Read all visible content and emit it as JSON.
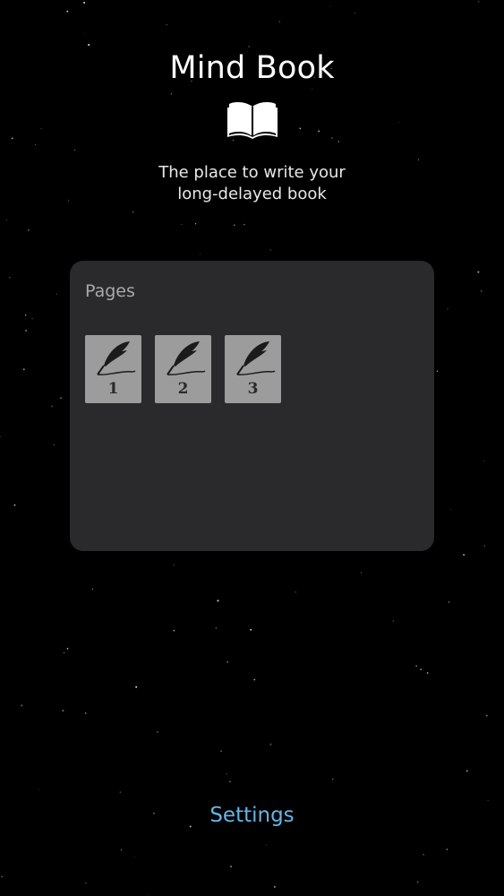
{
  "app": {
    "title": "Mind Book",
    "tagline_line1": "The place to write your",
    "tagline_line2": "long-delayed book"
  },
  "pages_panel": {
    "heading": "Pages",
    "pages": [
      {
        "number": "1",
        "icon": "quill-icon"
      },
      {
        "number": "2",
        "icon": "quill-icon"
      },
      {
        "number": "3",
        "icon": "quill-icon"
      }
    ]
  },
  "footer": {
    "settings_label": "Settings"
  },
  "colors": {
    "background": "#000000",
    "panel": "#2a2a2c",
    "tile": "#9c9c9c",
    "link": "#64b5e6"
  }
}
